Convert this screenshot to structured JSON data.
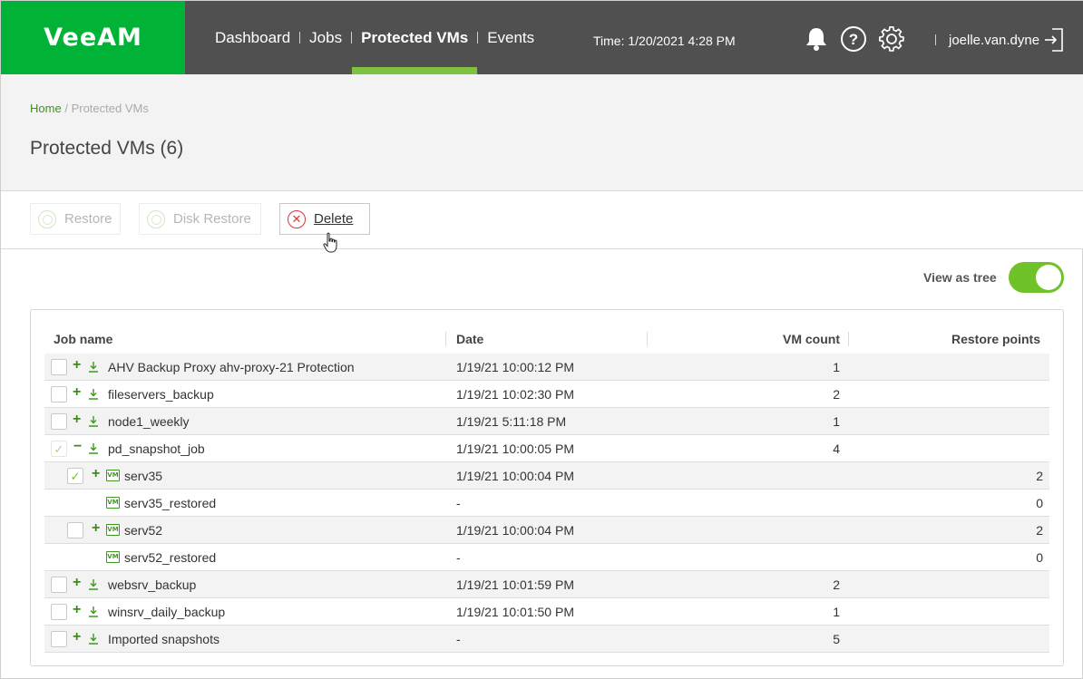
{
  "header": {
    "logo": "VeeAM",
    "nav": [
      "Dashboard",
      "Jobs",
      "Protected VMs",
      "Events"
    ],
    "active_nav": "Protected VMs",
    "time": "Time: 1/20/2021 4:28 PM",
    "username": "joelle.van.dyne",
    "icons": [
      "bell-icon",
      "help-icon",
      "gear-icon",
      "logout-icon"
    ]
  },
  "breadcrumb": {
    "home": "Home",
    "current": "Protected VMs",
    "separator": "/"
  },
  "page_title": "Protected VMs (6)",
  "toolbar": {
    "restore": "Restore",
    "disk_restore": "Disk Restore",
    "delete": "Delete"
  },
  "view_as_tree": {
    "label": "View as tree",
    "enabled": true
  },
  "table": {
    "columns": [
      "Job name",
      "Date",
      "VM count",
      "Restore points"
    ],
    "rows": [
      {
        "name": "AHV Backup Proxy ahv-proxy-21 Protection",
        "date": "1/19/21 10:00:12 PM",
        "vm_count": "1",
        "restore_points": ""
      },
      {
        "name": "fileservers_backup",
        "date": "1/19/21 10:02:30 PM",
        "vm_count": "2",
        "restore_points": ""
      },
      {
        "name": "node1_weekly",
        "date": "1/19/21 5:11:18 PM",
        "vm_count": "1",
        "restore_points": ""
      },
      {
        "name": "pd_snapshot_job",
        "date": "1/19/21 10:00:05 PM",
        "vm_count": "4",
        "restore_points": ""
      },
      {
        "name": "serv35",
        "date": "1/19/21 10:00:04 PM",
        "vm_count": "",
        "restore_points": "2"
      },
      {
        "name": "serv35_restored",
        "date": "-",
        "vm_count": "",
        "restore_points": "0"
      },
      {
        "name": "serv52",
        "date": "1/19/21 10:00:04 PM",
        "vm_count": "",
        "restore_points": "2"
      },
      {
        "name": "serv52_restored",
        "date": "-",
        "vm_count": "",
        "restore_points": "0"
      },
      {
        "name": "websrv_backup",
        "date": "1/19/21 10:01:59 PM",
        "vm_count": "2",
        "restore_points": ""
      },
      {
        "name": "winsrv_daily_backup",
        "date": "1/19/21 10:01:50 PM",
        "vm_count": "1",
        "restore_points": ""
      },
      {
        "name": "Imported snapshots",
        "date": "-",
        "vm_count": "5",
        "restore_points": ""
      }
    ]
  },
  "vm_icon_text": "VM",
  "colors": {
    "brand_green": "#00b336",
    "accent_green": "#7fc242",
    "header_bg": "#505050",
    "delete_red": "#d9383a"
  }
}
